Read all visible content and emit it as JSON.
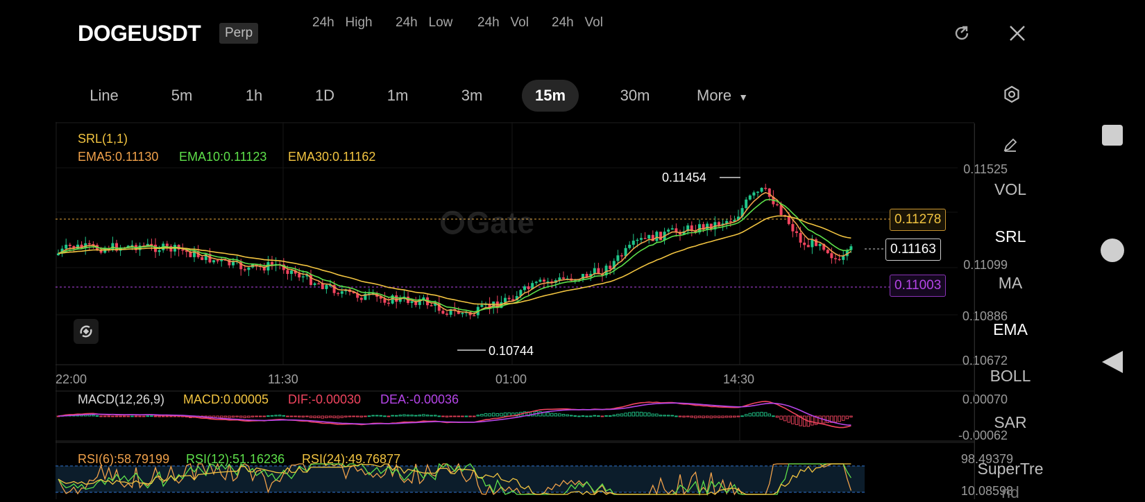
{
  "header": {
    "symbol": "DOGEUSDT",
    "badge": "Perp",
    "stats": [
      "24h   High",
      "24h   Low",
      "24h   Vol",
      "24h   Vol"
    ]
  },
  "timeframes": [
    "Line",
    "5m",
    "1h",
    "1D",
    "1m",
    "3m",
    "15m",
    "30m",
    "More"
  ],
  "active_timeframe": "15m",
  "main_chart": {
    "srl_label": "SRL(1,1)",
    "ema5": "EMA5:0.11130",
    "ema10": "EMA10:0.11123",
    "ema30": "EMA30:0.11162",
    "price_ticks": [
      "0.11525",
      "0.11099",
      "0.10886",
      "0.10672"
    ],
    "high_label": "0.11454",
    "low_label": "0.10744",
    "tag_upper": "0.11278",
    "tag_current": "0.11163",
    "tag_lower": "0.11003",
    "watermark": "Gate",
    "time_ticks": [
      "22:00",
      "11:30",
      "01:00",
      "14:30"
    ]
  },
  "macd": {
    "label": "MACD(12,26,9)",
    "macd": "MACD:0.00005",
    "dif": "DIF:-0.00030",
    "dea": "DEA:-0.00036",
    "ticks": [
      "0.00070",
      "-0.00062"
    ]
  },
  "rsi": {
    "rsi6": "RSI(6):58.79199",
    "rsi12": "RSI(12):51.16236",
    "rsi24": "RSI(24):49.76877",
    "ticks": [
      "98.49379",
      "10.08598"
    ]
  },
  "indicators": [
    "VOL",
    "SRL",
    "MA",
    "EMA",
    "BOLL",
    "SAR",
    "SuperTre",
    "nd"
  ],
  "active_indicators": [
    "SRL",
    "EMA"
  ],
  "colors": {
    "up": "#20c78a",
    "down": "#f0445e",
    "ema5": "#f0a14a",
    "ema10": "#5ee04a",
    "ema30": "#f2c440",
    "purple": "#b545e8"
  },
  "icons": {
    "share": "share-icon",
    "close": "close-icon",
    "settings": "settings-hexagon-icon",
    "pencil": "pencil-icon",
    "rotate": "rotate-icon",
    "nav_square": "square-nav-icon",
    "nav_circle": "circle-nav-icon",
    "nav_back": "back-triangle-icon"
  }
}
